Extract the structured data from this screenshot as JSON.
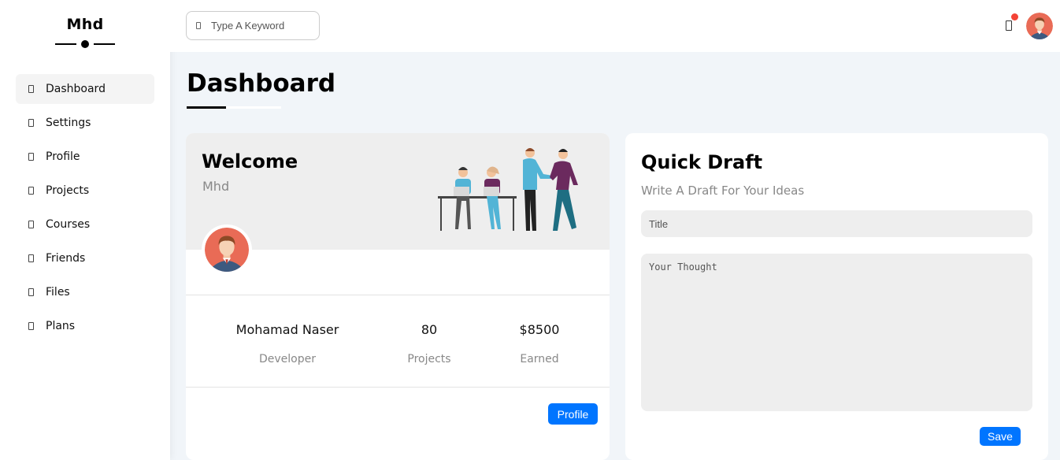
{
  "brand": {
    "name": "Mhd"
  },
  "sidebar": {
    "items": [
      {
        "label": "Dashboard",
        "icon": "square-icon",
        "active": true
      },
      {
        "label": "Settings",
        "icon": "square-icon"
      },
      {
        "label": "Profile",
        "icon": "square-icon"
      },
      {
        "label": "Projects",
        "icon": "square-icon"
      },
      {
        "label": "Courses",
        "icon": "square-icon"
      },
      {
        "label": "Friends",
        "icon": "square-icon"
      },
      {
        "label": "Files",
        "icon": "square-icon"
      },
      {
        "label": "Plans",
        "icon": "square-icon"
      }
    ]
  },
  "header": {
    "search": {
      "placeholder": "Type A Keyword"
    },
    "notification": {
      "icon": "bell-icon",
      "dot_color": "#f44336"
    }
  },
  "page": {
    "title": "Dashboard"
  },
  "welcome": {
    "title": "Welcome",
    "subtitle": "Mhd",
    "stats": {
      "name": {
        "value": "Mohamad Naser",
        "label": "Developer"
      },
      "projects": {
        "value": "80",
        "label": "Projects"
      },
      "earned": {
        "value": "$8500",
        "label": "Earned"
      }
    },
    "profile_button": "Profile"
  },
  "quick_draft": {
    "title": "Quick Draft",
    "subtitle": "Write A Draft For Your Ideas",
    "title_placeholder": "Title",
    "thought_placeholder": "Your Thought",
    "save_button": "Save"
  },
  "colors": {
    "accent": "#0075ff",
    "background": "#f1f5f9",
    "notification": "#f44336"
  }
}
